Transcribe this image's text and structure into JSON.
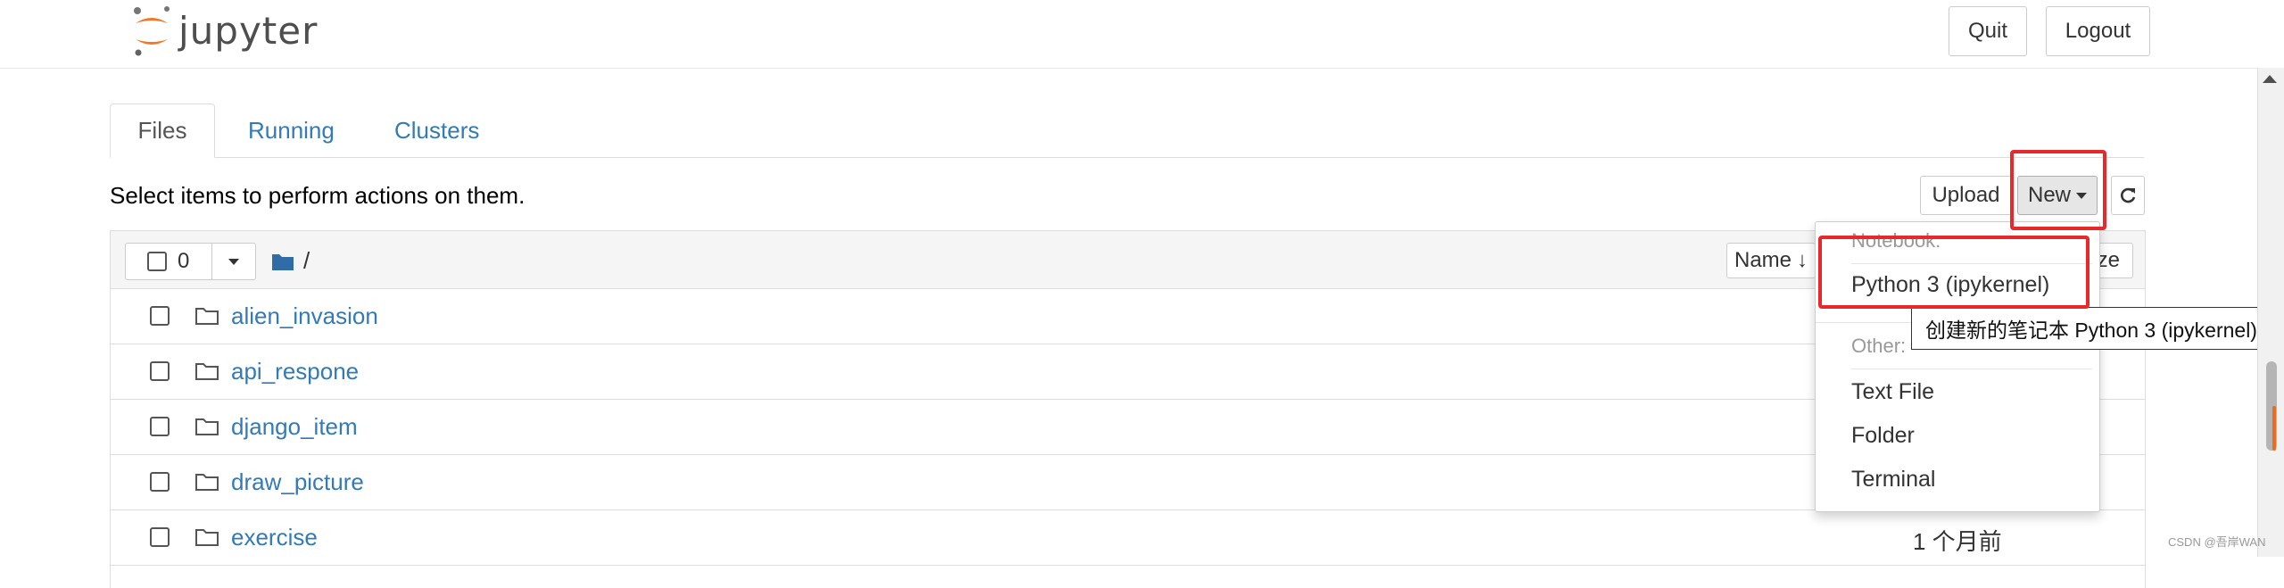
{
  "header": {
    "logo_text": "jupyter",
    "quit_label": "Quit",
    "logout_label": "Logout"
  },
  "tabs": [
    {
      "label": "Files"
    },
    {
      "label": "Running"
    },
    {
      "label": "Clusters"
    }
  ],
  "toolbar": {
    "hint": "Select items to perform actions on them.",
    "upload_label": "Upload",
    "new_label": "New"
  },
  "list_header": {
    "selected_count": "0",
    "breadcrumb": "/",
    "name_sort_label": "Name",
    "size_sort_label": "ze"
  },
  "files": [
    {
      "name": "alien_invasion",
      "modified": ""
    },
    {
      "name": "api_respone",
      "modified": ""
    },
    {
      "name": "django_item",
      "modified": ""
    },
    {
      "name": "draw_picture",
      "modified": ""
    },
    {
      "name": "exercise",
      "modified": "1 个月前"
    }
  ],
  "new_menu": {
    "notebook_header": "Notebook:",
    "python_kernel": "Python 3 (ipykernel)",
    "other_header": "Other:",
    "text_file": "Text File",
    "folder": "Folder",
    "terminal": "Terminal"
  },
  "tooltip": "创建新的笔记本 Python 3 (ipykernel)",
  "watermark": "CSDN @吾岸WAN",
  "colors": {
    "link": "#337ab7",
    "highlight": "#e8292b",
    "logo_orange": "#f37726"
  }
}
